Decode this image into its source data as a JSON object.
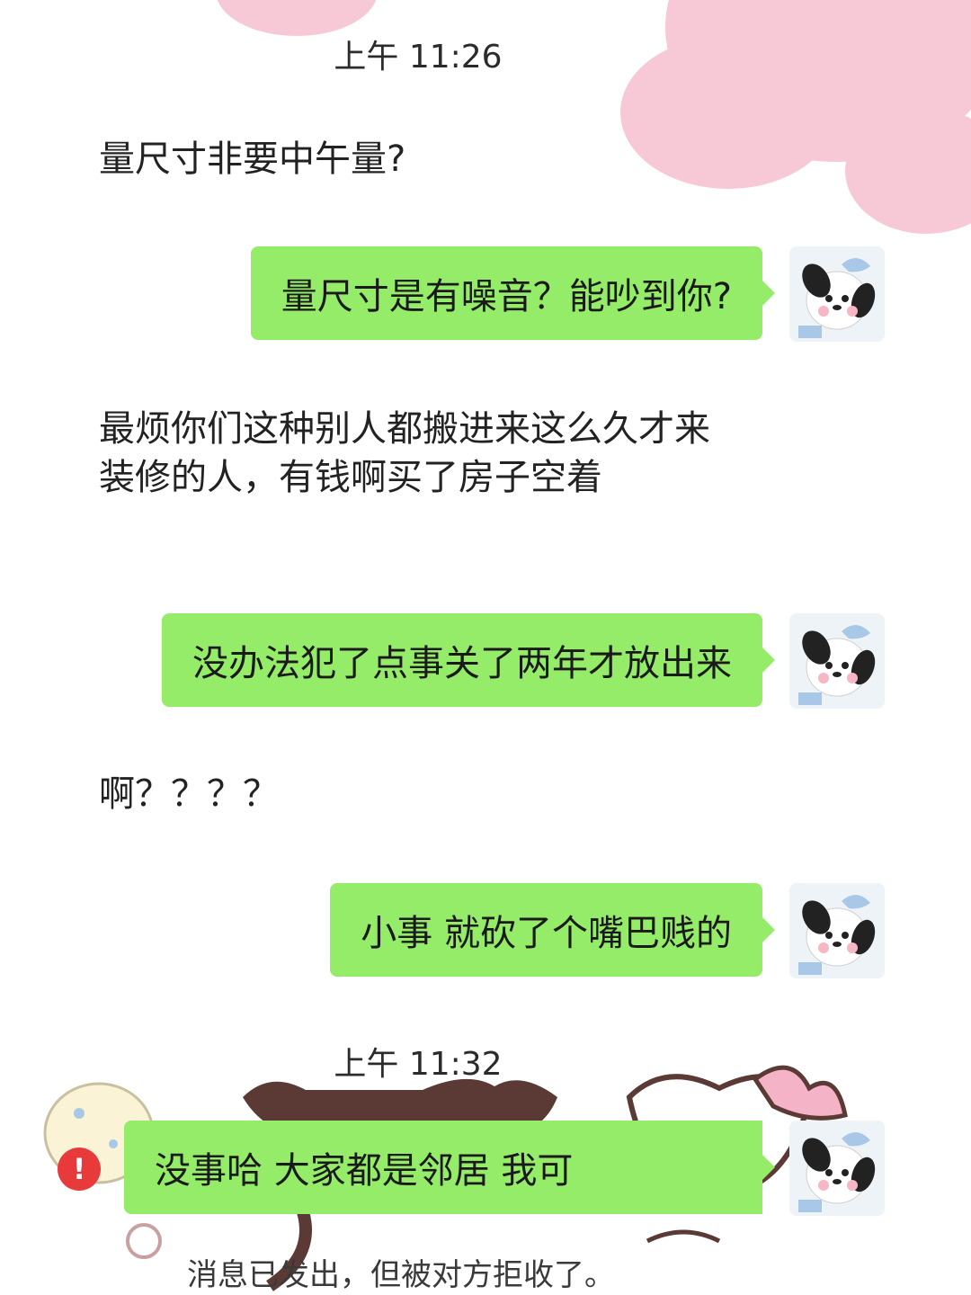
{
  "colors": {
    "outgoing_bubble": "#95ec69",
    "background": "#ffffff",
    "wallpaper_pink": "#f7c9d6",
    "error_red": "#e83a3a"
  },
  "timestamps": [
    "上午 11:26",
    "上午 11:32"
  ],
  "messages": [
    {
      "side": "incoming",
      "text": "量尺寸非要中午量?"
    },
    {
      "side": "outgoing",
      "text": "量尺寸是有噪音？能吵到你?"
    },
    {
      "side": "incoming",
      "text": "最烦你们这种别人都搬进来这么久才来装修的人，有钱啊买了房子空着"
    },
    {
      "side": "outgoing",
      "text": "没办法犯了点事关了两年才放出来"
    },
    {
      "side": "incoming",
      "text": "啊？？？？"
    },
    {
      "side": "outgoing",
      "text": "小事 就砍了个嘴巴贱的"
    },
    {
      "side": "outgoing",
      "text": "没事哈 大家都是邻居 我可",
      "status": "rejected"
    }
  ],
  "error_icon": {
    "icon": "exclamation-icon",
    "glyph": "!"
  },
  "system_notice": "消息已发出，但被对方拒收了。",
  "avatar": {
    "icon": "plush-toy-avatar-icon"
  }
}
